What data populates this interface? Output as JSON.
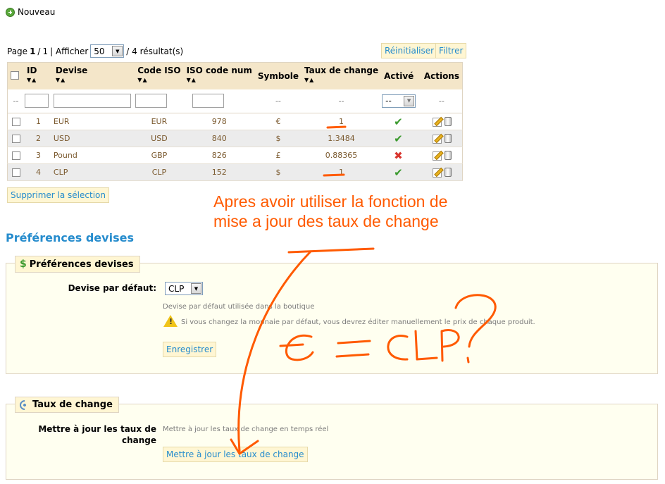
{
  "toolbar": {
    "new_label": "Nouveau"
  },
  "pagination": {
    "page_prefix": "Page",
    "current": "1",
    "separator": "/",
    "total_pages": "1",
    "show_label": "| Afficher",
    "per_page": "50",
    "results": "/ 4 résultat(s)"
  },
  "actions": {
    "reset": "Réinitialiser",
    "filter": "Filtrer"
  },
  "table": {
    "headers": {
      "id": "ID",
      "currency": "Devise",
      "iso": "Code ISO",
      "iso_num": "ISO code num",
      "symbol": "Symbole",
      "rate": "Taux de change",
      "active": "Activé",
      "actions": "Actions"
    },
    "filter_placeholder": "--",
    "active_filter_value": "--",
    "rows": [
      {
        "id": "1",
        "name": "EUR",
        "iso": "EUR",
        "iso_num": "978",
        "symbol": "€",
        "rate": "1",
        "active": true
      },
      {
        "id": "2",
        "name": "USD",
        "iso": "USD",
        "iso_num": "840",
        "symbol": "$",
        "rate": "1.3484",
        "active": true
      },
      {
        "id": "3",
        "name": "Pound",
        "iso": "GBP",
        "iso_num": "826",
        "symbol": "£",
        "rate": "0.88365",
        "active": false
      },
      {
        "id": "4",
        "name": "CLP",
        "iso": "CLP",
        "iso_num": "152",
        "symbol": "$",
        "rate": "1",
        "active": true
      }
    ]
  },
  "delete_selection": "Supprimer la sélection",
  "annotation": {
    "line1": "Apres avoir  utiliser la fonction de",
    "line2": "mise a jour des taux de change",
    "handwritten": "€ = CLP?"
  },
  "preferences": {
    "title": "Préférences devises",
    "legend": "Préférences devises",
    "default_label": "Devise par défaut:",
    "default_value": "CLP",
    "default_hint": "Devise par défaut utilisée dans la boutique",
    "warning": "Si vous changez la monnaie par défaut, vous devrez éditer manuellement le prix de chaque produit.",
    "save": "Enregistrer"
  },
  "exchange": {
    "legend": "Taux de change",
    "update_label_line1": "Mettre à jour les taux de",
    "update_label_line2": "change",
    "hint": "Mettre à jour les taux de change en temps réel",
    "update_button": "Mettre à jour les taux de change"
  },
  "colors": {
    "accent": "#268ccd",
    "annotation": "#ff5a00",
    "panel_bg": "#fffff0",
    "header_bg": "#f4e6c9"
  }
}
